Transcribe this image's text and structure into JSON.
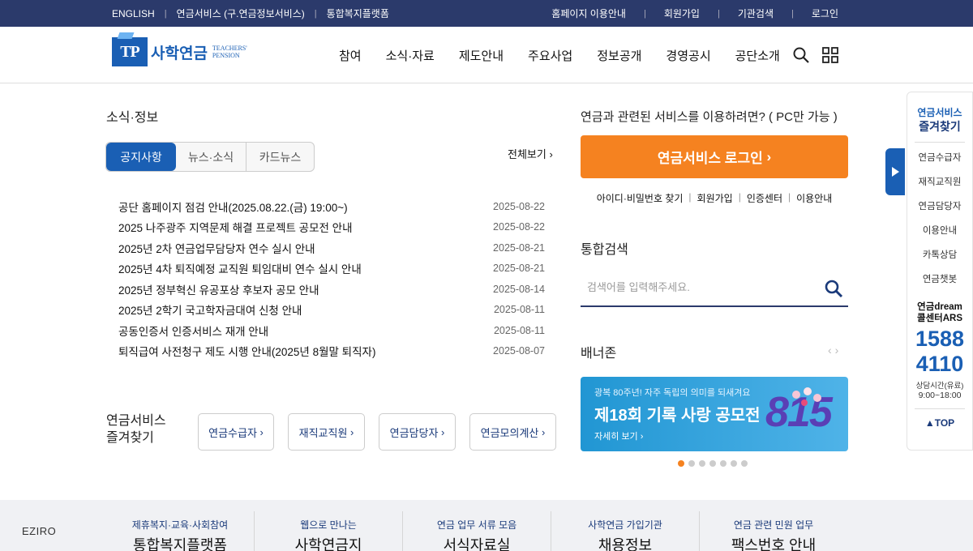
{
  "topbar": {
    "links_left": [
      "ENGLISH",
      "연금서비스 (구.연금정보서비스)",
      "통합복지플랫폼"
    ],
    "links_right": [
      "홈페이지 이용안내",
      "회원가입",
      "기관검색",
      "로그인"
    ]
  },
  "logo": {
    "mark": "TP",
    "name": "사학연금",
    "en_line1": "TEACHERS'",
    "en_line2": "PENSION"
  },
  "nav": [
    "참여",
    "소식·자료",
    "제도안내",
    "주요사업",
    "정보공개",
    "경영공시",
    "공단소개"
  ],
  "news": {
    "title": "소식·정보",
    "tabs": [
      "공지사항",
      "뉴스·소식",
      "카드뉴스"
    ],
    "more": "전체보기",
    "items": [
      {
        "title": "공단 홈페이지 점검 안내(2025.08.22.(금) 19:00~)",
        "date": "2025-08-22"
      },
      {
        "title": "2025 나주광주 지역문제 해결 프로젝트 공모전 안내",
        "date": "2025-08-22"
      },
      {
        "title": "2025년 2차 연금업무담당자 연수 실시 안내",
        "date": "2025-08-21"
      },
      {
        "title": "2025년 4차 퇴직예정 교직원 퇴임대비 연수 실시 안내",
        "date": "2025-08-21"
      },
      {
        "title": "2025년 정부혁신 유공포상 후보자 공모 안내",
        "date": "2025-08-14"
      },
      {
        "title": "2025년 2학기 국고학자금대여 신청 안내",
        "date": "2025-08-11"
      },
      {
        "title": "공동인증서 인증서비스 재개 안내",
        "date": "2025-08-11"
      },
      {
        "title": "퇴직급여 사전청구 제도 시행 안내(2025년 8월말 퇴직자)",
        "date": "2025-08-07"
      }
    ]
  },
  "quick": {
    "title_line1": "연금서비스",
    "title_line2": "즐겨찾기",
    "buttons": [
      "연금수급자",
      "재직교직원",
      "연금담당자",
      "연금모의계산"
    ]
  },
  "login": {
    "question": "연금과 관련된 서비스를 이용하려면? ( PC만 가능 )",
    "button": "연금서비스 로그인",
    "links": [
      "아이디·비밀번호 찾기",
      "회원가입",
      "인증센터",
      "이용안내"
    ]
  },
  "search": {
    "title": "통합검색",
    "placeholder": "검색어를 입력해주세요."
  },
  "banner": {
    "title": "배너존",
    "subtitle": "광복 80주년! 자주 독립의 의미를 되새겨요",
    "headline": "제18회 기록 사랑 공모전",
    "link": "자세히 보기",
    "art": "815",
    "dots": 7,
    "active_dot": 0
  },
  "quickbar": {
    "title_line1": "연금서비스",
    "title_line2": "즐겨찾기",
    "items": [
      "연금수급자",
      "재직교직원",
      "연금담당자",
      "이용안내",
      "카톡상담",
      "연금챗봇"
    ],
    "callcenter_line1": "연금dream",
    "callcenter_line2": "콜센터ARS",
    "phone1": "1588",
    "phone2": "4110",
    "hours_label": "상담시간(유료)",
    "hours": "9:00~18:00",
    "top": "TOP"
  },
  "footer": {
    "brand": "EZIRO",
    "cols": [
      {
        "small": "제휴복지·교육·사회참여",
        "big": "통합복지플랫폼"
      },
      {
        "small": "웹으로 만나는",
        "big": "사학연금지"
      },
      {
        "small": "연금 업무 서류 모음",
        "big": "서식자료실"
      },
      {
        "small": "사학연금 가입기관",
        "big": "채용정보"
      },
      {
        "small": "연금 관련 민원 업무",
        "big": "팩스번호 안내"
      }
    ]
  },
  "colors": {
    "navy": "#2b3a6b",
    "brand_blue": "#1a5fb4",
    "orange": "#f58220"
  }
}
